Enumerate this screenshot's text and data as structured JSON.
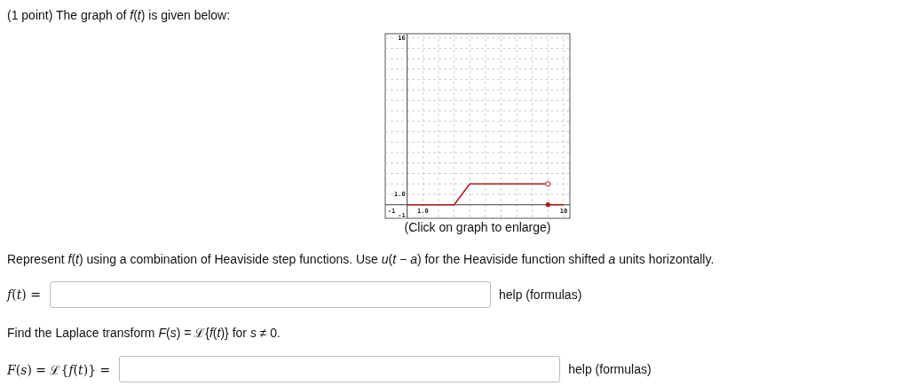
{
  "intro": "(1 point) The graph of *f*(*t*) is given below:",
  "graph": {
    "caption": "(Click on graph to enlarge)",
    "chart_data": {
      "type": "line",
      "x": [
        0,
        3,
        4,
        9,
        10
      ],
      "series": [
        {
          "color": "#b01c1c",
          "values": [
            0,
            0,
            2,
            2,
            null
          ]
        },
        {
          "color": "#b01c1c",
          "values": [
            null,
            null,
            null,
            0,
            0
          ]
        }
      ],
      "grid": true,
      "xlim": [
        -1.4,
        10.4
      ],
      "ylim": [
        -1.3,
        16.4
      ],
      "xticks": [
        {
          "value": -1,
          "label": "-1"
        },
        {
          "value": 1,
          "label": "1.0"
        },
        {
          "value": 10,
          "label": "10"
        }
      ],
      "yticks": [
        {
          "value": -1,
          "label": "-1"
        },
        {
          "value": 1,
          "label": "1.0"
        },
        {
          "value": 16,
          "label": "16"
        }
      ]
    }
  },
  "instruction": "Represent *f*(*t*) using a combination of Heaviside step functions. Use *u*(*t* − *a*) for the Heaviside function shifted *a* units horizontally.",
  "answers": [
    {
      "prompt": "*f*(*t*) =",
      "link": "help (formulas)"
    },
    {
      "before": "Find the Laplace transform *F*(*s*) = ℒ{*f*(*t*)} for *s* ≠ 0.",
      "prompt": "*F*(*s*) = ℒ{*f*(*t*)} =",
      "link": "help (formulas)"
    }
  ]
}
